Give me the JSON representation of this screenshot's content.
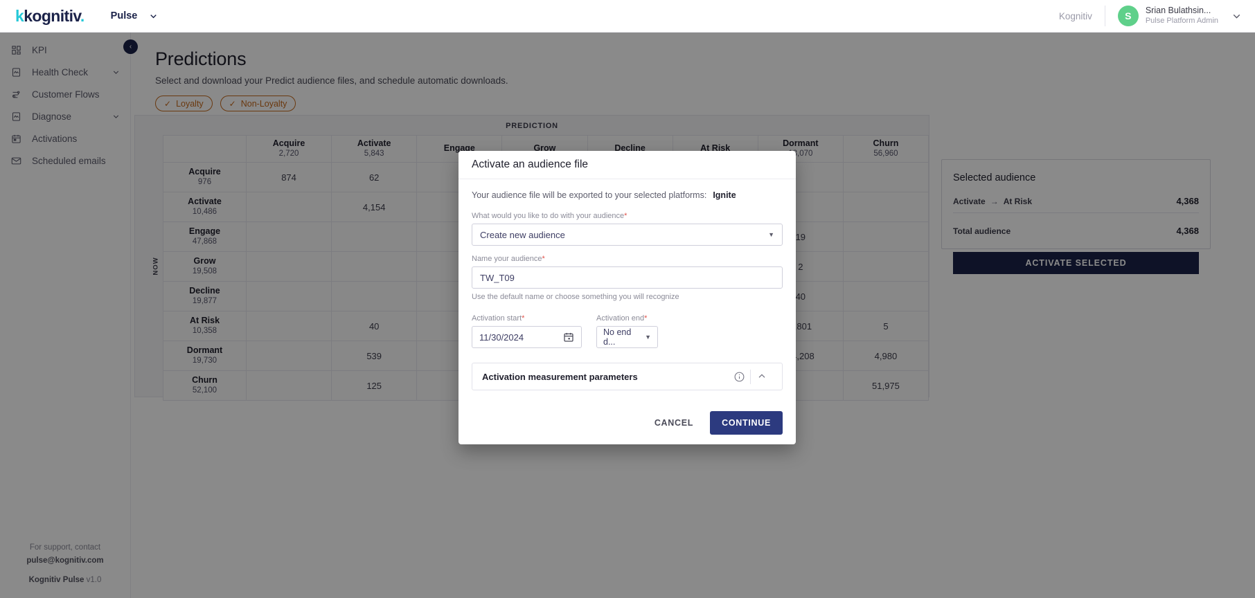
{
  "topbar": {
    "logo_text": "kognitiv",
    "product": "Pulse",
    "tenant": "Kognitiv",
    "avatar_initial": "S",
    "user_name": "Srian Bulathsin...",
    "user_role": "Pulse Platform Admin"
  },
  "sidebar": {
    "items": [
      {
        "label": "KPI",
        "icon": "grid-icon",
        "has_chevron": false
      },
      {
        "label": "Health Check",
        "icon": "health-check-icon",
        "has_chevron": true
      },
      {
        "label": "Customer Flows",
        "icon": "flows-icon",
        "has_chevron": false
      },
      {
        "label": "Diagnose",
        "icon": "diagnose-icon",
        "has_chevron": true
      },
      {
        "label": "Activations",
        "icon": "calendar-icon",
        "has_chevron": false
      },
      {
        "label": "Scheduled emails",
        "icon": "envelope-icon",
        "has_chevron": false
      }
    ],
    "footer": {
      "support_line": "For support, contact",
      "support_email": "pulse@kognitiv.com",
      "app_name": "Kognitiv Pulse",
      "version": "v1.0"
    },
    "collapse_glyph": "‹"
  },
  "page": {
    "title": "Predictions",
    "subtitle": "Select and download your Predict audience files, and schedule automatic downloads.",
    "chips": [
      {
        "label": "Loyalty",
        "checked": true
      },
      {
        "label": "Non-Loyalty",
        "checked": true
      }
    ]
  },
  "matrix": {
    "title": "PREDICTION",
    "row_axis_label": "NOW",
    "columns": [
      {
        "name": "Acquire",
        "value": "2,720"
      },
      {
        "name": "Activate",
        "value": "5,843"
      },
      {
        "name": "Engage",
        "value": ""
      },
      {
        "name": "Grow",
        "value": ""
      },
      {
        "name": "Decline",
        "value": ""
      },
      {
        "name": "At Risk",
        "value": ""
      },
      {
        "name": "Dormant",
        "value": "18,070"
      },
      {
        "name": "Churn",
        "value": "56,960"
      }
    ],
    "rows": [
      {
        "name": "Acquire",
        "value": "976",
        "cells": [
          "874",
          "62",
          "",
          "",
          "",
          "",
          "",
          ""
        ]
      },
      {
        "name": "Activate",
        "value": "10,486",
        "cells": [
          "",
          "4,154",
          "",
          "",
          "",
          "",
          "",
          ""
        ]
      },
      {
        "name": "Engage",
        "value": "47,868",
        "cells": [
          "",
          "",
          "",
          "",
          "",
          "",
          "19",
          ""
        ]
      },
      {
        "name": "Grow",
        "value": "19,508",
        "cells": [
          "",
          "",
          "",
          "",
          "",
          "",
          "2",
          ""
        ]
      },
      {
        "name": "Decline",
        "value": "19,877",
        "cells": [
          "",
          "",
          "",
          "",
          "",
          "",
          "40",
          ""
        ]
      },
      {
        "name": "At Risk",
        "value": "10,358",
        "cells": [
          "",
          "40",
          "",
          "",
          "",
          "",
          "3,801",
          "5"
        ]
      },
      {
        "name": "Dormant",
        "value": "19,730",
        "cells": [
          "",
          "539",
          "",
          "",
          "",
          "",
          "14,208",
          "4,980"
        ]
      },
      {
        "name": "Churn",
        "value": "52,100",
        "cells": [
          "",
          "125",
          "",
          "",
          "",
          "",
          "",
          "51,975"
        ]
      }
    ]
  },
  "selected_audience": {
    "title": "Selected audience",
    "row_from": "Activate",
    "row_arrow": "→",
    "row_to": "At Risk",
    "row_value": "4,368",
    "total_label": "Total audience",
    "total_value": "4,368",
    "button_label": "ACTIVATE SELECTED"
  },
  "modal": {
    "title": "Activate an audience file",
    "export_text": "Your audience file will be exported to your selected platforms:",
    "export_platform": "Ignite",
    "audience_action": {
      "label": "What would you like to do with your audience",
      "required_mark": "*",
      "value": "Create new audience"
    },
    "audience_name": {
      "label": "Name your audience",
      "required_mark": "*",
      "value": "TW_T09",
      "helper": "Use the default name or choose something you will recognize"
    },
    "activation_start": {
      "label": "Activation start",
      "required_mark": "*",
      "value": "11/30/2024"
    },
    "activation_end": {
      "label": "Activation end",
      "required_mark": "*",
      "value": "No end d..."
    },
    "accordion": {
      "title": "Activation measurement parameters",
      "info_icon": "info-icon",
      "toggle_icon": "chevron-up-icon"
    },
    "cancel_label": "CANCEL",
    "continue_label": "CONTINUE"
  },
  "colors": {
    "brand_navy": "#1b2249",
    "brand_teal": "#24c8d8",
    "chip_orange": "#c4691d",
    "primary_button": "#2c3a7f",
    "avatar_green": "#5fd08a",
    "required_red": "#e0524a"
  }
}
